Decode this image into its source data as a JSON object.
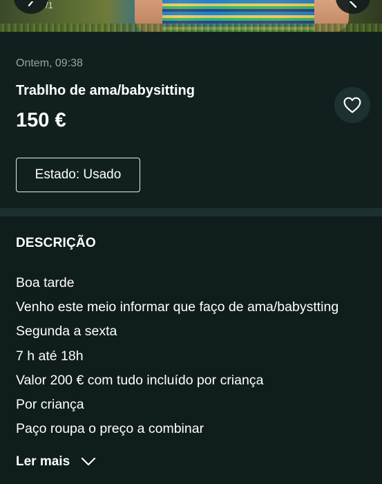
{
  "gallery": {
    "counter": "/1"
  },
  "listing": {
    "timestamp": "Ontem, 09:38",
    "title": "Trablho de ama/babysitting",
    "price": "150 €",
    "state_badge": "Estado: Usado"
  },
  "description": {
    "heading": "DESCRIÇÃO",
    "lines": [
      "Boa tarde",
      "Venho este meio informar que faço de ama/babystting",
      "Segunda a sexta",
      "7 h até 18h",
      "Valor 200 € com tudo incluído por criança",
      "Por criança",
      "Paço roupa o preço a combinar"
    ],
    "read_more_label": "Ler mais"
  },
  "icons": {
    "favorite": "heart-outline-icon",
    "read_more": "chevron-down-icon",
    "gallery_back": "chevron-left-icon",
    "gallery_share": "share-icon"
  },
  "colors": {
    "background": "#0e1b1c",
    "panel": "#11201f",
    "muted_text": "#97a4a3",
    "divider": "#1d302f"
  }
}
